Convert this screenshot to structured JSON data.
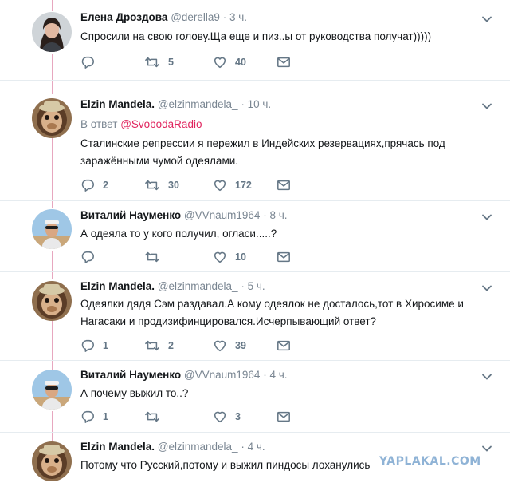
{
  "tweets": [
    {
      "name": "Елена Дроздова",
      "handle": "@derella9",
      "time": "· 3 ч.",
      "text_lines": [
        "Спросили на свою голову.Ща еще и пиз..ы от руководства получат)))))"
      ],
      "reply_count": "",
      "retweet_count": "5",
      "like_count": "40",
      "avatar": "woman-avatar"
    },
    {
      "name": "Elzin Mandela.",
      "handle": "@elzinmandela_",
      "time": "· 10 ч.",
      "reply_prefix": "В ответ",
      "reply_target": "@SvobodaRadio",
      "text_lines": [
        "Сталинские репрессии я пережил в Индейских резервациях,прячась  под",
        "заражёнными чумой одеялами."
      ],
      "reply_count": "2",
      "retweet_count": "30",
      "like_count": "172",
      "avatar": "monkey-avatar"
    },
    {
      "name": "Виталий Науменко",
      "handle": "@VVnaum1964",
      "time": "· 8 ч.",
      "text_lines": [
        "А одеяла то у кого получил, огласи.....?"
      ],
      "reply_count": "",
      "retweet_count": "",
      "like_count": "10",
      "avatar": "man-avatar"
    },
    {
      "name": "Elzin Mandela.",
      "handle": "@elzinmandela_",
      "time": "· 5 ч.",
      "text_lines": [
        "Одеялки дядя Сэм раздавал.А кому одеялок не досталось,тот в Хиросиме и",
        "Нагасаки и продизифинцировался.Исчерпывающий ответ?"
      ],
      "reply_count": "1",
      "retweet_count": "2",
      "like_count": "39",
      "avatar": "monkey-avatar"
    },
    {
      "name": "Виталий Науменко",
      "handle": "@VVnaum1964",
      "time": "· 4 ч.",
      "text_lines": [
        "А почему выжил то..?"
      ],
      "reply_count": "1",
      "retweet_count": "",
      "like_count": "3",
      "avatar": "man-avatar"
    },
    {
      "name": "Elzin Mandela.",
      "handle": "@elzinmandela_",
      "time": "· 4 ч.",
      "text_lines": [
        "Потому что Русский,потому и выжил пиндосы лоханулись"
      ],
      "avatar": "monkey-avatar"
    }
  ],
  "watermark": "YAPLAKAL.COM",
  "colors": {
    "thread_line": "#e7a7bf",
    "link": "#e0245e",
    "muted": "#657786"
  }
}
